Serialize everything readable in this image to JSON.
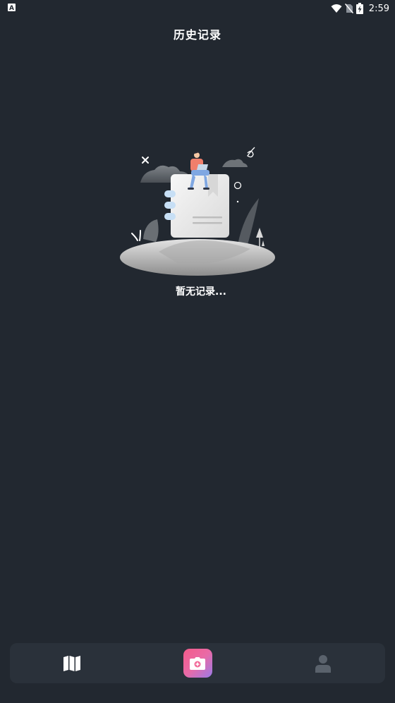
{
  "status_bar": {
    "time": "2:59",
    "left_icon": "a-notification-icon",
    "icons": [
      "wifi-icon",
      "no-sim-icon",
      "battery-charging-icon"
    ]
  },
  "header": {
    "title": "历史记录"
  },
  "empty_state": {
    "message": "暂无记录...",
    "illustration": "empty-notebook-illustration"
  },
  "bottom_nav": {
    "items": [
      {
        "icon": "map-icon",
        "active": true
      },
      {
        "icon": "camera-icon",
        "active": false
      },
      {
        "icon": "person-icon",
        "active": false
      }
    ]
  },
  "colors": {
    "background": "#222830",
    "nav_background": "#2a313a",
    "camera_gradient_start": "#f45b8a",
    "camera_gradient_end": "#9b7ae8",
    "inactive_icon": "#5a626c"
  }
}
